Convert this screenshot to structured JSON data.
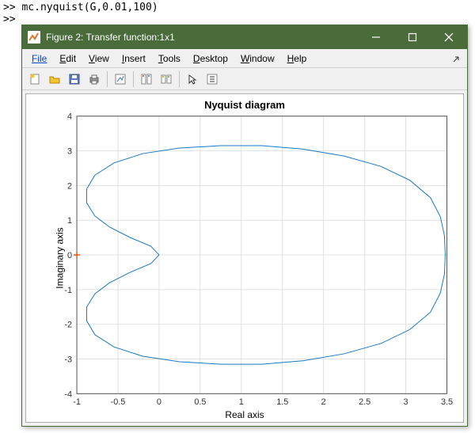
{
  "terminal": {
    "line1": ">> mc.nyquist(G,0.01,100)",
    "line2": ">>"
  },
  "window": {
    "title": "Figure 2: Transfer function:1x1"
  },
  "menubar": {
    "file": "File",
    "edit": "Edit",
    "view": "View",
    "insert": "Insert",
    "tools": "Tools",
    "desktop": "Desktop",
    "window": "Window",
    "help": "Help"
  },
  "chart_data": {
    "type": "line",
    "title": "Nyquist diagram",
    "xlabel": "Real axis",
    "ylabel": "Imaginary axis",
    "xlim": [
      -1,
      3.5
    ],
    "ylim": [
      -4,
      4
    ],
    "xticks": [
      -1,
      -0.5,
      0,
      0.5,
      1,
      1.5,
      2,
      2.5,
      3,
      3.5
    ],
    "yticks": [
      -4,
      -3,
      -2,
      -1,
      0,
      1,
      2,
      3,
      4
    ],
    "grid": true,
    "critical_point": {
      "x": -1,
      "y": 0
    },
    "series": [
      {
        "name": "Nyquist",
        "color": "#1878c2",
        "points": [
          {
            "re": 0.0,
            "im": 0.0
          },
          {
            "re": -0.1,
            "im": 0.25
          },
          {
            "re": -0.35,
            "im": 0.5
          },
          {
            "re": -0.6,
            "im": 0.8
          },
          {
            "re": -0.78,
            "im": 1.12
          },
          {
            "re": -0.88,
            "im": 1.5
          },
          {
            "re": -0.88,
            "im": 1.9
          },
          {
            "re": -0.78,
            "im": 2.3
          },
          {
            "re": -0.55,
            "im": 2.65
          },
          {
            "re": -0.2,
            "im": 2.92
          },
          {
            "re": 0.25,
            "im": 3.08
          },
          {
            "re": 0.75,
            "im": 3.15
          },
          {
            "re": 1.25,
            "im": 3.15
          },
          {
            "re": 1.75,
            "im": 3.05
          },
          {
            "re": 2.25,
            "im": 2.85
          },
          {
            "re": 2.7,
            "im": 2.55
          },
          {
            "re": 3.05,
            "im": 2.15
          },
          {
            "re": 3.3,
            "im": 1.65
          },
          {
            "re": 3.42,
            "im": 1.1
          },
          {
            "re": 3.47,
            "im": 0.55
          },
          {
            "re": 3.48,
            "im": 0.0
          },
          {
            "re": 3.47,
            "im": -0.55
          },
          {
            "re": 3.42,
            "im": -1.1
          },
          {
            "re": 3.3,
            "im": -1.65
          },
          {
            "re": 3.05,
            "im": -2.15
          },
          {
            "re": 2.7,
            "im": -2.55
          },
          {
            "re": 2.25,
            "im": -2.85
          },
          {
            "re": 1.75,
            "im": -3.05
          },
          {
            "re": 1.25,
            "im": -3.15
          },
          {
            "re": 0.75,
            "im": -3.15
          },
          {
            "re": 0.25,
            "im": -3.08
          },
          {
            "re": -0.2,
            "im": -2.92
          },
          {
            "re": -0.55,
            "im": -2.65
          },
          {
            "re": -0.78,
            "im": -2.3
          },
          {
            "re": -0.88,
            "im": -1.9
          },
          {
            "re": -0.88,
            "im": -1.5
          },
          {
            "re": -0.78,
            "im": -1.12
          },
          {
            "re": -0.6,
            "im": -0.8
          },
          {
            "re": -0.35,
            "im": -0.5
          },
          {
            "re": -0.1,
            "im": -0.25
          },
          {
            "re": 0.0,
            "im": 0.0
          }
        ]
      }
    ]
  }
}
